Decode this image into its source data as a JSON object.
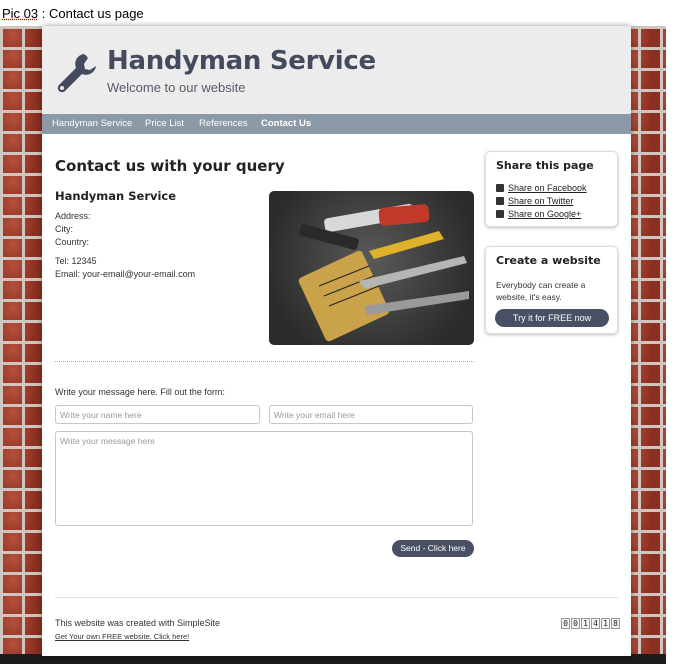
{
  "caption": {
    "pic": "Pic 03",
    "rest": " : Contact us page"
  },
  "header": {
    "title": "Handyman Service",
    "subtitle": "Welcome to our website",
    "logo_icon": "wrench-icon"
  },
  "nav": {
    "items": [
      {
        "label": "Handyman Service",
        "active": false
      },
      {
        "label": "Price List",
        "active": false
      },
      {
        "label": "References",
        "active": false
      },
      {
        "label": "Contact Us",
        "active": true
      }
    ]
  },
  "main": {
    "heading": "Contact us with your query",
    "business_name": "Handyman Service",
    "address_label": "Address:",
    "city_label": "City:",
    "country_label": "Country:",
    "tel": "Tel: 12345",
    "email": "Email: your-email@your-email.com",
    "photo_icon": "tools-photo"
  },
  "form": {
    "intro": "Write your message here. Fill out the form:",
    "name_placeholder": "Write your name here",
    "email_placeholder": "Write your email here",
    "message_placeholder": "Write your message here",
    "send_label": "Send - Click here"
  },
  "share": {
    "title": "Share this page",
    "links": [
      {
        "label": "Share on Facebook",
        "icon": "facebook-icon"
      },
      {
        "label": "Share on Twitter",
        "icon": "twitter-icon"
      },
      {
        "label": "Share on Google+",
        "icon": "google-plus-icon"
      }
    ]
  },
  "create": {
    "title": "Create a website",
    "text": "Everybody can create a website, it's easy.",
    "button": "Try it for FREE now"
  },
  "footer": {
    "credit": "This website was created with SimpleSite",
    "link": "Get Your own FREE website. Click here!",
    "counter": [
      "0",
      "0",
      "1",
      "4",
      "1",
      "8"
    ]
  },
  "colors": {
    "nav_bg": "#8c9aa7",
    "title": "#444b5e",
    "button": "#4a5063",
    "brick": "#9a3a2c"
  }
}
